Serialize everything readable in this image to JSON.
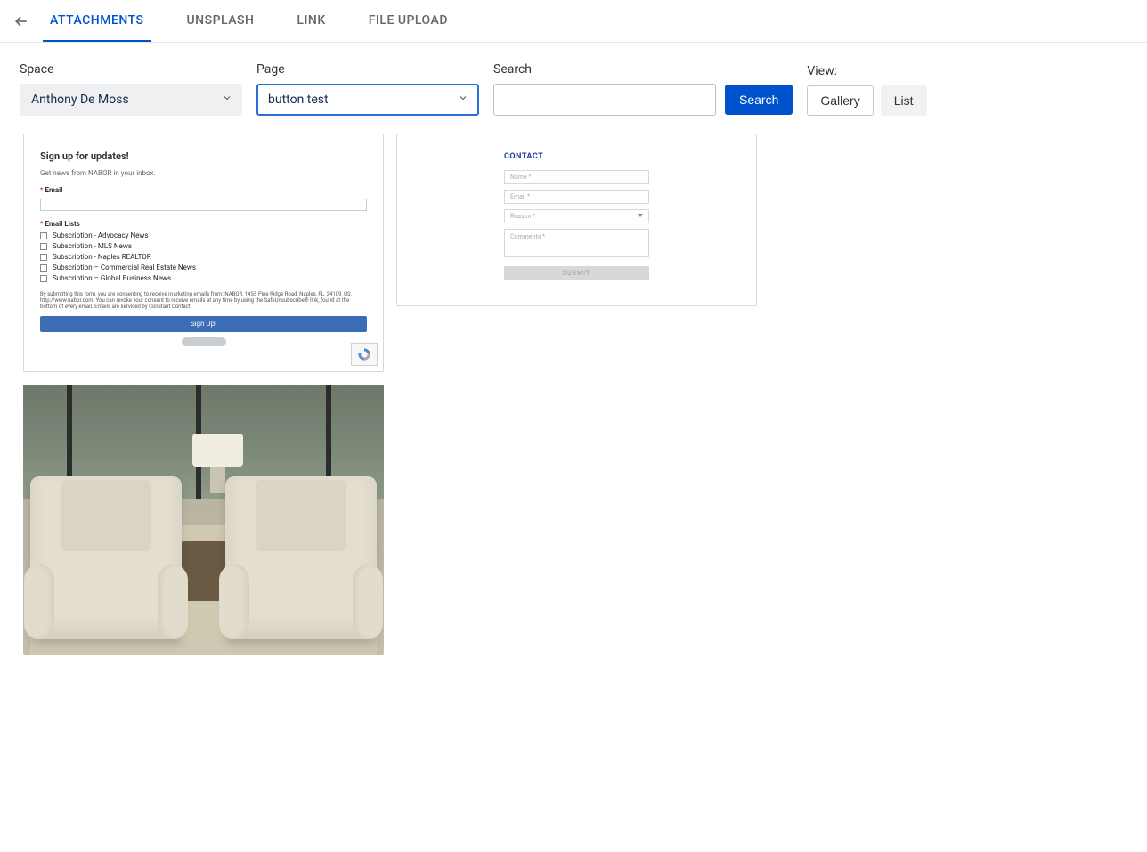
{
  "tabs": {
    "attachments": "ATTACHMENTS",
    "unsplash": "UNSPLASH",
    "link": "LINK",
    "file_upload": "FILE UPLOAD"
  },
  "controls": {
    "space_label": "Space",
    "space_value": "Anthony De Moss",
    "page_label": "Page",
    "page_value": "button test",
    "search_label": "Search",
    "search_value": "",
    "search_button": "Search",
    "view_label": "View:",
    "view_gallery": "Gallery",
    "view_list": "List"
  },
  "card1": {
    "title": "Sign up for updates!",
    "subtitle": "Get news from NABOR in your inbox.",
    "email_label": "Email",
    "lists_label": "Email Lists",
    "options": [
      "Subscription - Advocacy News",
      "Subscription - MLS News",
      "Subscription - Naples REALTOR",
      "Subscription – Commercial Real Estate News",
      "Subscription – Global Business News"
    ],
    "fineprint": "By submitting this form, you are consenting to receive marketing emails from: NABOR, 1455 Pine Ridge Road, Naples, FL, 34109, US, http://www.nabor.com. You can revoke your consent to receive emails at any time by using the SafeUnsubscribe® link, found at the bottom of every email. Emails are serviced by Constant Contact.",
    "button": "Sign Up!"
  },
  "card2": {
    "title": "CONTACT",
    "name": "Name *",
    "email": "Email *",
    "reason": "Reason *",
    "comments": "Comments *",
    "submit": "SUBMIT"
  }
}
